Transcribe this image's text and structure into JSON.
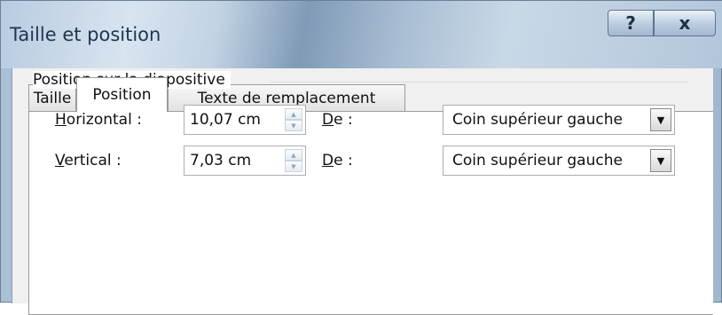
{
  "window": {
    "title": "Taille et position",
    "help_label": "?",
    "close_label": "x"
  },
  "tabs": [
    {
      "label": "Taille"
    },
    {
      "label": "Position",
      "active": true
    },
    {
      "label": "Texte de remplacement"
    }
  ],
  "group": {
    "title": "Position sur la diapositive"
  },
  "horizontal": {
    "label_first": "H",
    "label_rest": "orizontal :",
    "value": "10,07 cm",
    "de_first": "D",
    "de_rest": "e :",
    "from": "Coin supérieur gauche"
  },
  "vertical": {
    "label_first": "V",
    "label_rest": "ertical :",
    "value": "7,03 cm",
    "de_first": "D",
    "de_rest": "e :",
    "from": "Coin supérieur gauche"
  },
  "icons": {
    "spin_up": "up-arrow",
    "spin_down": "down-arrow",
    "dropdown": "triangle-down"
  }
}
